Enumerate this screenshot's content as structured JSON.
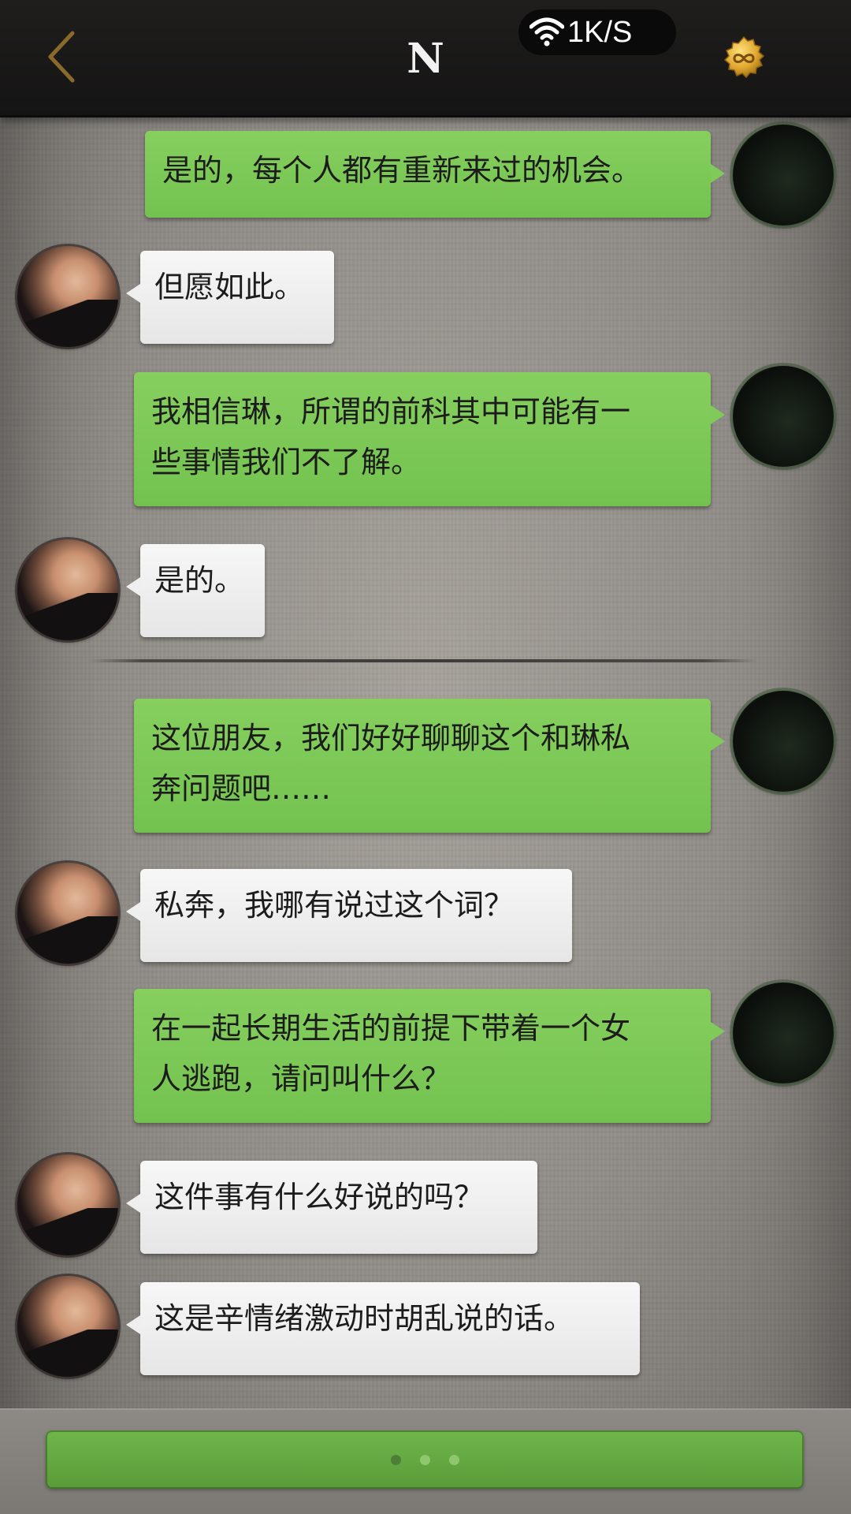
{
  "header": {
    "title": "N",
    "net_speed": "1K/S",
    "back_icon": "chevron-left-icon",
    "wifi_icon": "wifi-icon",
    "coin_icon": "infinity-coin-icon"
  },
  "messages": [
    {
      "side": "me",
      "text_lines": [
        "是的，每个人都有重新来过的机会。"
      ]
    },
    {
      "side": "other",
      "text_lines": [
        "但愿如此。"
      ]
    },
    {
      "side": "me",
      "text_lines": [
        "我相信琳，所谓的前科其中可能有一",
        "些事情我们不了解。"
      ]
    },
    {
      "side": "other",
      "text_lines": [
        "是的。"
      ]
    },
    {
      "side": "me",
      "text_lines": [
        "这位朋友，我们好好聊聊这个和琳私",
        "奔问题吧……"
      ]
    },
    {
      "side": "other",
      "text_lines": [
        "私奔，我哪有说过这个词？"
      ]
    },
    {
      "side": "me",
      "text_lines": [
        "在一起长期生活的前提下带着一个女",
        "人逃跑，请问叫什么？"
      ]
    },
    {
      "side": "other",
      "text_lines": [
        "这件事有什么好说的吗？"
      ]
    },
    {
      "side": "other",
      "text_lines": [
        "这是辛情绪激动时胡乱说的话。"
      ]
    }
  ],
  "colors": {
    "header_bg": "#1a1918",
    "my_bubble": "#7dc756",
    "other_bubble": "#eeeeee",
    "back_icon": "#8a6a2a",
    "coin": "#e0a830"
  }
}
